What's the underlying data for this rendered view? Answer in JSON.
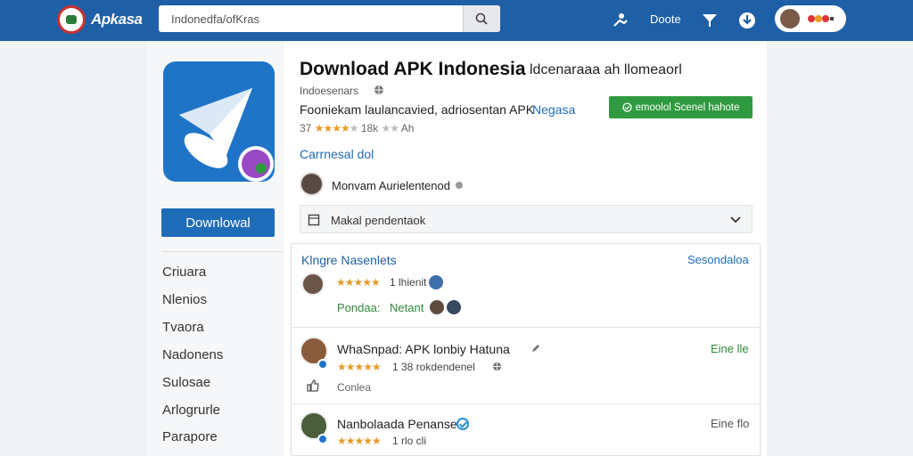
{
  "header": {
    "logo_text": "Apkasa",
    "search": {
      "value": "Indonedfa/ofKras",
      "placeholder": ""
    },
    "nav_text": "Doote",
    "colors": {
      "bar": "#1f5fa6",
      "accent": "#2f9a3f"
    }
  },
  "app": {
    "title": "Download APK Indonesia",
    "title_suffix": "ldcenaraaa ah llomeaorl",
    "developer": "Indoesenars",
    "description": "Fooniekam laulancavied, adriosentan APK",
    "description_link": "Negasa",
    "install_button": "emoolol Scenel hahote",
    "rating_value": "37",
    "rating_count": "18k",
    "rating_extra": "Ah",
    "category_link": "Carrnesal dol",
    "author": "Monvam Aurielentenod",
    "download_button": "Downlowal"
  },
  "sidebar": {
    "categories": [
      "Criuara",
      "Nlenios",
      "Tvaora",
      "Nadonens",
      "Sulosae",
      "Arlogrurle",
      "Parapore"
    ]
  },
  "dropdown": {
    "label": "Makal pendentaok"
  },
  "reviews": {
    "title": "Klngre Nasenlets",
    "see_all": "Sesondaloa",
    "featured": {
      "meta": "1 lhienit",
      "action_left": "Pondaa:",
      "action_right": "Netant"
    },
    "items": [
      {
        "name": "WhaSnpad: APK lonbiy Hatuna",
        "meta": "1 38 rokdendenel",
        "action": "Eine lle",
        "footer": "Conlea"
      },
      {
        "name": "Nanbolaada Penanse",
        "meta": "1 rlo cli",
        "action": "Eine flo"
      }
    ]
  }
}
